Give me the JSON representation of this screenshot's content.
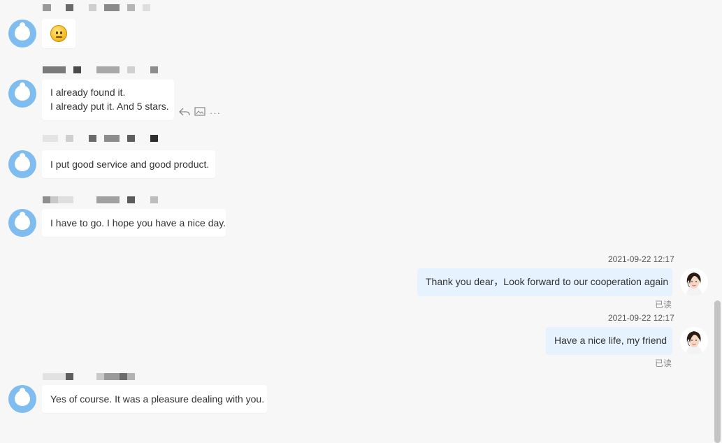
{
  "messages_left": [
    {
      "type": "emoji",
      "emoji": "slightly-smiling-face-icon"
    },
    {
      "lines": [
        "I already found it.",
        "I already put it. And 5 stars."
      ]
    },
    {
      "lines": [
        "I put good service and good product."
      ]
    },
    {
      "lines": [
        "I have to go. I hope you have a nice day."
      ]
    },
    {
      "lines": [
        "Yes of course. It was a pleasure dealing with you."
      ]
    }
  ],
  "messages_right": [
    {
      "time": "2021-09-22 12:17",
      "text": "Thank you dear，Look forward to our cooperation again",
      "status": "已读"
    },
    {
      "time": "2021-09-22 12:17",
      "text": "Have a nice life, my friend",
      "status": "已读"
    }
  ],
  "message_actions": {
    "reply_icon": "reply-icon",
    "image_icon": "image-icon",
    "more_label": "···"
  },
  "colors": {
    "background": "#f7f7f7",
    "customer_avatar": "#7fbcf0",
    "agent_bubble": "#e6f2fd",
    "customer_bubble": "#ffffff"
  }
}
